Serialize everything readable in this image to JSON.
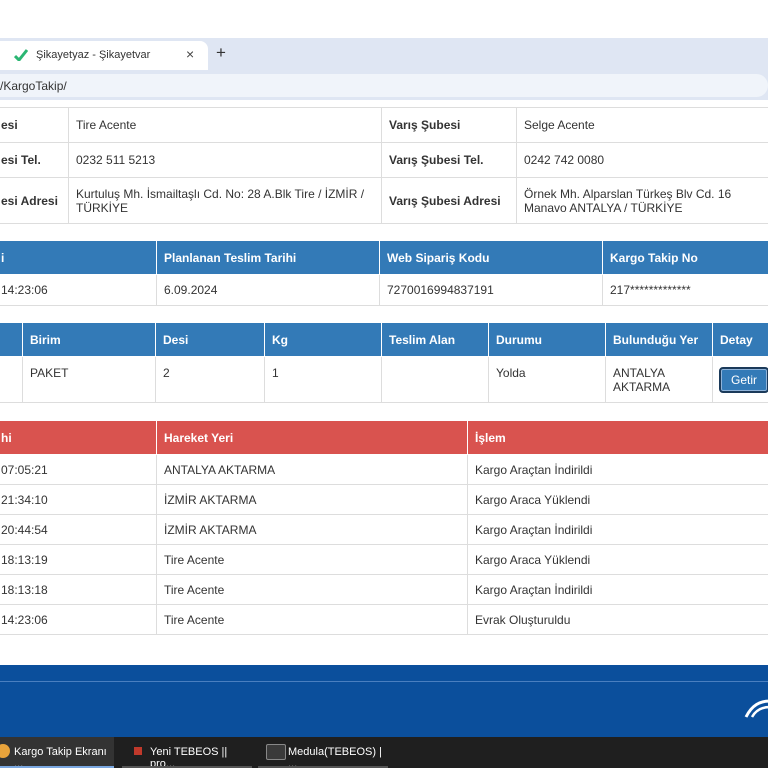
{
  "browser": {
    "tab_title": "Şikayetyaz - Şikayetvar",
    "tab_close": "×",
    "new_tab": "+",
    "address": "/KargoTakip/"
  },
  "info": {
    "rows": [
      {
        "l1": "esi",
        "v1": "Tire Acente",
        "l2": "Varış Şubesi",
        "v2": "Selge Acente"
      },
      {
        "l1": "esi Tel.",
        "v1": "0232 511 5213",
        "l2": "Varış Şubesi Tel.",
        "v2": "0242 742 0080"
      },
      {
        "l1": "esi Adresi",
        "v1": "Kurtuluş Mh. İsmailtaşlı Cd. No: 28 A.Blk Tire / İZMİR / TÜRKİYE",
        "l2": "Varış Şubesi Adresi",
        "v2": "Örnek Mh. Alparslan Türkeş Blv Cd. 16 Manavo ANTALYA / TÜRKİYE"
      }
    ]
  },
  "summary": {
    "headers": [
      "i",
      "Planlanan Teslim Tarihi",
      "Web Sipariş Kodu",
      "Kargo Takip No"
    ],
    "row": [
      "14:23:06",
      "6.09.2024",
      "7270016994837191",
      "217*************"
    ]
  },
  "detail": {
    "headers": [
      "",
      "Birim",
      "Desi",
      "Kg",
      "Teslim Alan",
      "Durumu",
      "Bulunduğu Yer",
      "Detay"
    ],
    "row": [
      "",
      "PAKET",
      "2",
      "1",
      "",
      "Yolda",
      "ANTALYA AKTARMA"
    ],
    "button": "Getir"
  },
  "movements": {
    "headers": [
      "hi",
      "Hareket Yeri",
      "İşlem"
    ],
    "rows": [
      [
        "07:05:21",
        "ANTALYA AKTARMA",
        "Kargo Araçtan İndirildi"
      ],
      [
        "21:34:10",
        "İZMİR AKTARMA",
        "Kargo Araca Yüklendi"
      ],
      [
        "20:44:54",
        "İZMİR AKTARMA",
        "Kargo Araçtan İndirildi"
      ],
      [
        "18:13:19",
        "Tire Acente",
        "Kargo Araca Yüklendi"
      ],
      [
        "18:13:18",
        "Tire Acente",
        "Kargo Araçtan İndirildi"
      ],
      [
        "14:23:06",
        "Tire Acente",
        "Evrak Oluşturuldu"
      ]
    ]
  },
  "taskbar": [
    {
      "label": "Kargo Takip Ekranı ...",
      "icon": "chrome-icon",
      "color": "#e8a33b"
    },
    {
      "label": "Yeni TEBEOS  ||  pro...",
      "icon": "app-icon",
      "color": "#c0392b"
    },
    {
      "label": "Medula(TEBEOS) | ...",
      "icon": "sgk-icon",
      "color": "#c0392b"
    }
  ],
  "colors": {
    "blue_header": "#337ab7",
    "red_header": "#d9534f",
    "footer": "#0b4f9c"
  }
}
